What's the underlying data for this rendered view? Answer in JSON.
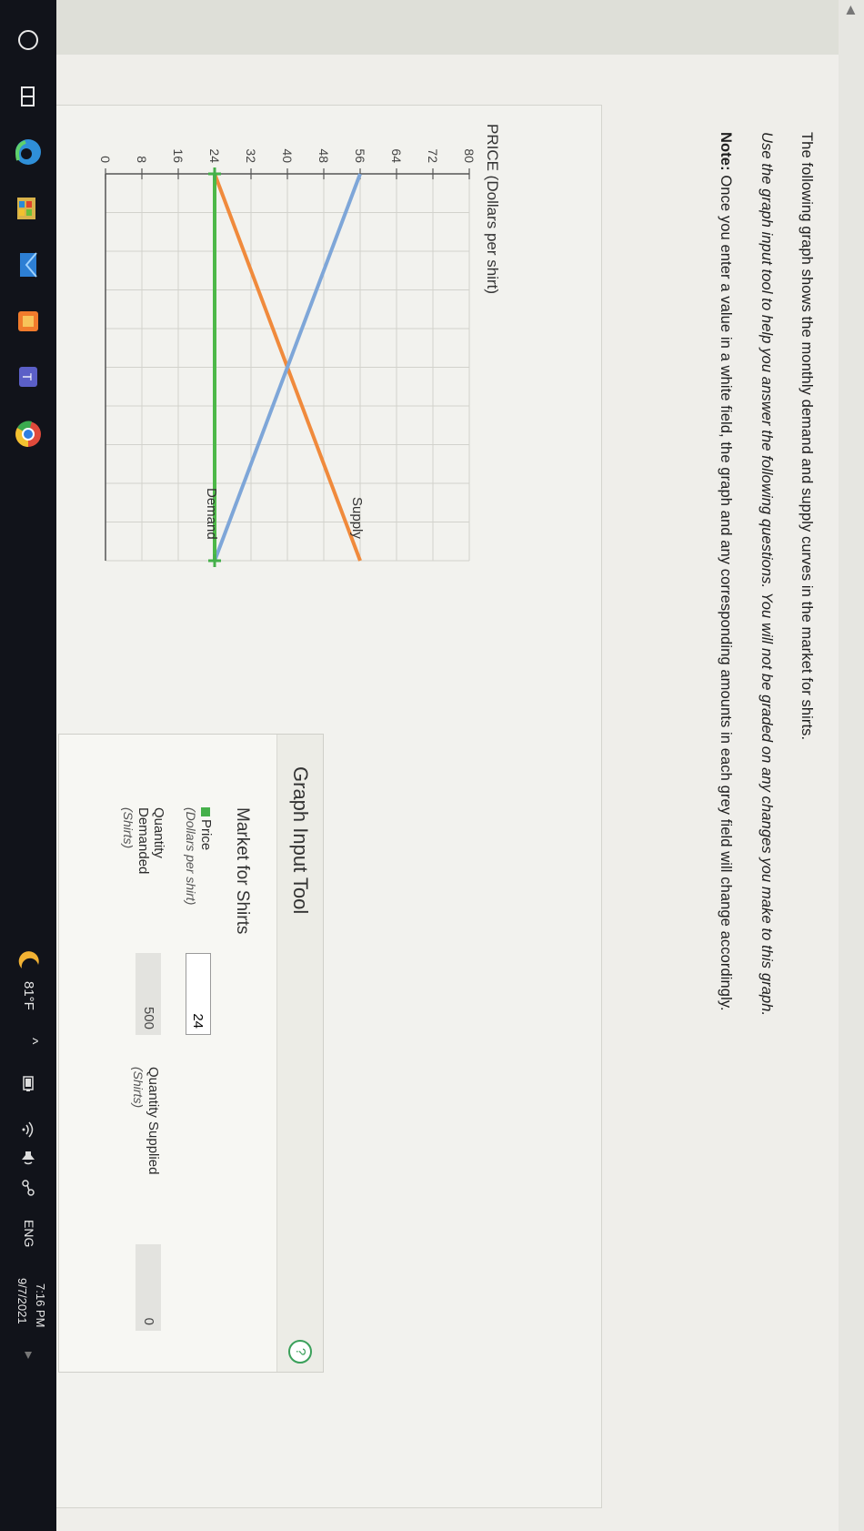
{
  "question": {
    "line1": "The following graph shows the monthly demand and supply curves in the market for shirts.",
    "line2": "Use the graph input tool to help you answer the following questions. You will not be graded on any changes you make to this graph.",
    "note_label": "Note:",
    "note_text": " Once you enter a value in a white field, the graph and any corresponding amounts in each grey field will change accordingly."
  },
  "graph": {
    "y_axis_title": "PRICE (Dollars per shirt)",
    "y_ticks": [
      "0",
      "8",
      "16",
      "24",
      "32",
      "40",
      "48",
      "56",
      "64",
      "72",
      "80"
    ],
    "supply_label": "Supply",
    "demand_label": "Demand"
  },
  "chart_data": {
    "type": "line",
    "ylabel": "PRICE (Dollars per shirt)",
    "ylim": [
      0,
      80
    ],
    "xlim": [
      0,
      1000
    ],
    "series": [
      {
        "name": "Supply",
        "x": [
          0,
          1000
        ],
        "y": [
          24,
          56
        ],
        "color": "#f08a3c"
      },
      {
        "name": "Demand",
        "x": [
          0,
          1000
        ],
        "y": [
          56,
          24
        ],
        "color": "#7ea6d8"
      },
      {
        "x": [
          0,
          1000
        ],
        "y": [
          24,
          24
        ],
        "color": "#4db848"
      }
    ]
  },
  "tool": {
    "title": "Graph Input Tool",
    "market_title": "Market for Shirts",
    "price_label": "Price",
    "price_unit": "(Dollars per shirt)",
    "price_value": "24",
    "qd_label_1": "Quantity",
    "qd_label_2": "Demanded",
    "qd_unit": "(Shirts)",
    "qd_value": "500",
    "qs_label": "Quantity Supplied",
    "qs_unit": "(Shirts)",
    "qs_value": "0"
  },
  "taskbar": {
    "weather": "81°F",
    "lang": "ENG",
    "time": "7:16 PM",
    "date": "9/7/2021"
  },
  "colors": {
    "supply": "#f08a3c",
    "demand": "#7ea6d8",
    "price_line": "#4db848",
    "help": "#3aa05a",
    "taskbar": "#11131a"
  }
}
